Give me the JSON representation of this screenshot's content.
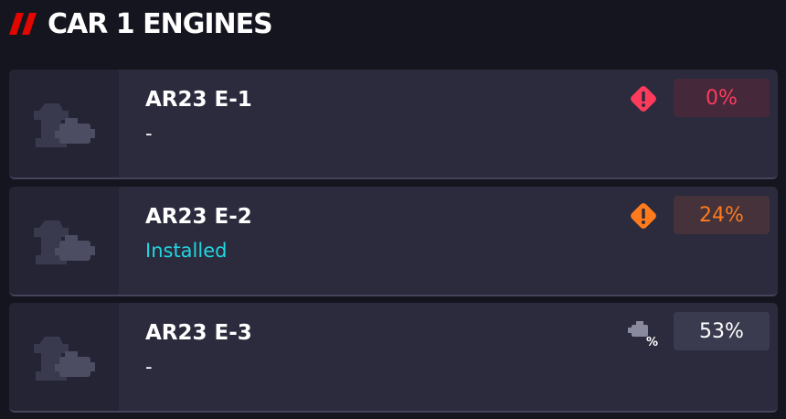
{
  "header": {
    "title": "CAR 1 ENGINES",
    "accent_color": "#e10600"
  },
  "engines": [
    {
      "name": "AR23 E-1",
      "status": "-",
      "wear_percent": "0%",
      "warning_icon": "critical-warning-icon",
      "color": "#ff3b5c",
      "badge_bg": "#45283a"
    },
    {
      "name": "AR23 E-2",
      "status": "Installed",
      "wear_percent": "24%",
      "warning_icon": "warning-icon",
      "color": "#ff7a1c",
      "badge_bg": "#45323a"
    },
    {
      "name": "AR23 E-3",
      "status": "-",
      "wear_percent": "53%",
      "warning_icon": "engine-wear-icon",
      "color": "#ffffff",
      "badge_bg": "#3b3b50"
    }
  ],
  "installed_color": "#22d6e0"
}
